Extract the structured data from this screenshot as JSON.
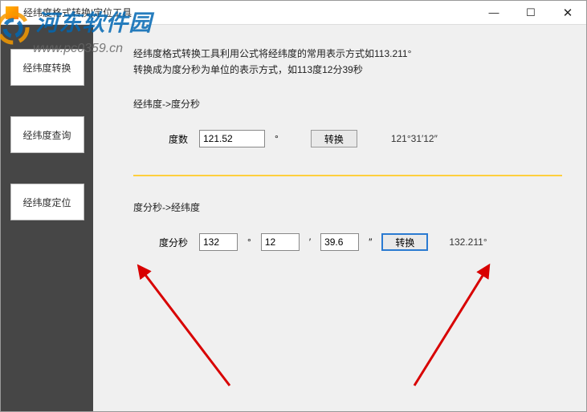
{
  "window": {
    "title": "经纬度格式转换|定位工具"
  },
  "sidebar": {
    "items": [
      {
        "label": "经纬度转换"
      },
      {
        "label": "经纬度查询"
      },
      {
        "label": "经纬度定位"
      }
    ]
  },
  "main": {
    "description_line1": "经纬度格式转换工具利用公式将经纬度的常用表示方式如113.211°",
    "description_line2": "转换成为度分秒为单位的表示方式，如113度12分39秒",
    "sec1": {
      "title": "经纬度->度分秒",
      "label": "度数",
      "input_value": "121.52",
      "unit": "°",
      "button": "转换",
      "result": "121°31′12″"
    },
    "sec2": {
      "title": "度分秒->经纬度",
      "label": "度分秒",
      "deg": "132",
      "deg_unit": "°",
      "min": "12",
      "min_unit": "′",
      "sec": "39.6",
      "sec_unit": "″",
      "button": "转换",
      "result": "132.211°"
    }
  },
  "watermark": {
    "text": "河东软件园",
    "url": "www.pc0359.cn"
  }
}
